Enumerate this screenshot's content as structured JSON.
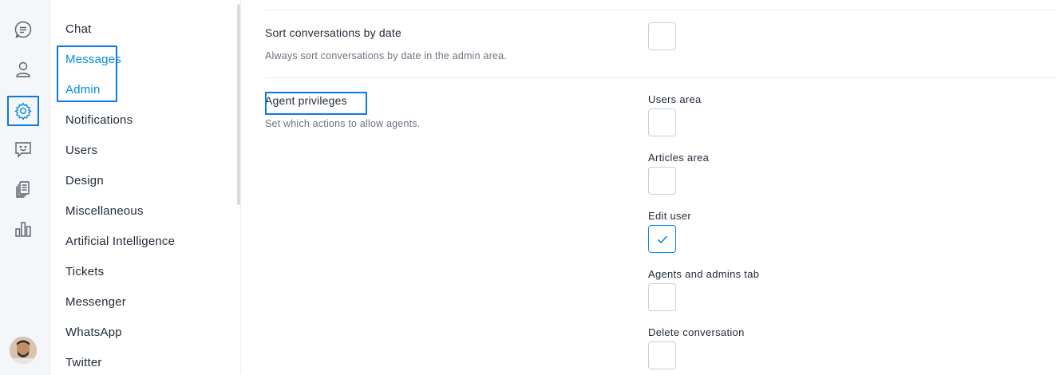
{
  "rail": {
    "icons": [
      "chat-icon",
      "user-icon",
      "settings-icon",
      "chatbot-icon",
      "articles-icon",
      "reports-icon"
    ],
    "active_color": "#028be5"
  },
  "nav": {
    "items": [
      {
        "label": "Chat"
      },
      {
        "label": "Messages"
      },
      {
        "label": "Admin"
      },
      {
        "label": "Notifications"
      },
      {
        "label": "Users"
      },
      {
        "label": "Design"
      },
      {
        "label": "Miscellaneous"
      },
      {
        "label": "Artificial Intelligence"
      },
      {
        "label": "Tickets"
      },
      {
        "label": "Messenger"
      },
      {
        "label": "WhatsApp"
      },
      {
        "label": "Twitter"
      }
    ]
  },
  "sort_setting": {
    "title": "Sort conversations by date",
    "description": "Always sort conversations by date in the admin area.",
    "checked": false
  },
  "privileges": {
    "title": "Agent privileges",
    "description": "Set which actions to allow agents.",
    "options": [
      {
        "label": "Users area",
        "checked": false
      },
      {
        "label": "Articles area",
        "checked": false
      },
      {
        "label": "Edit user",
        "checked": true
      },
      {
        "label": "Agents and admins tab",
        "checked": false
      },
      {
        "label": "Delete conversation",
        "checked": false
      }
    ]
  }
}
